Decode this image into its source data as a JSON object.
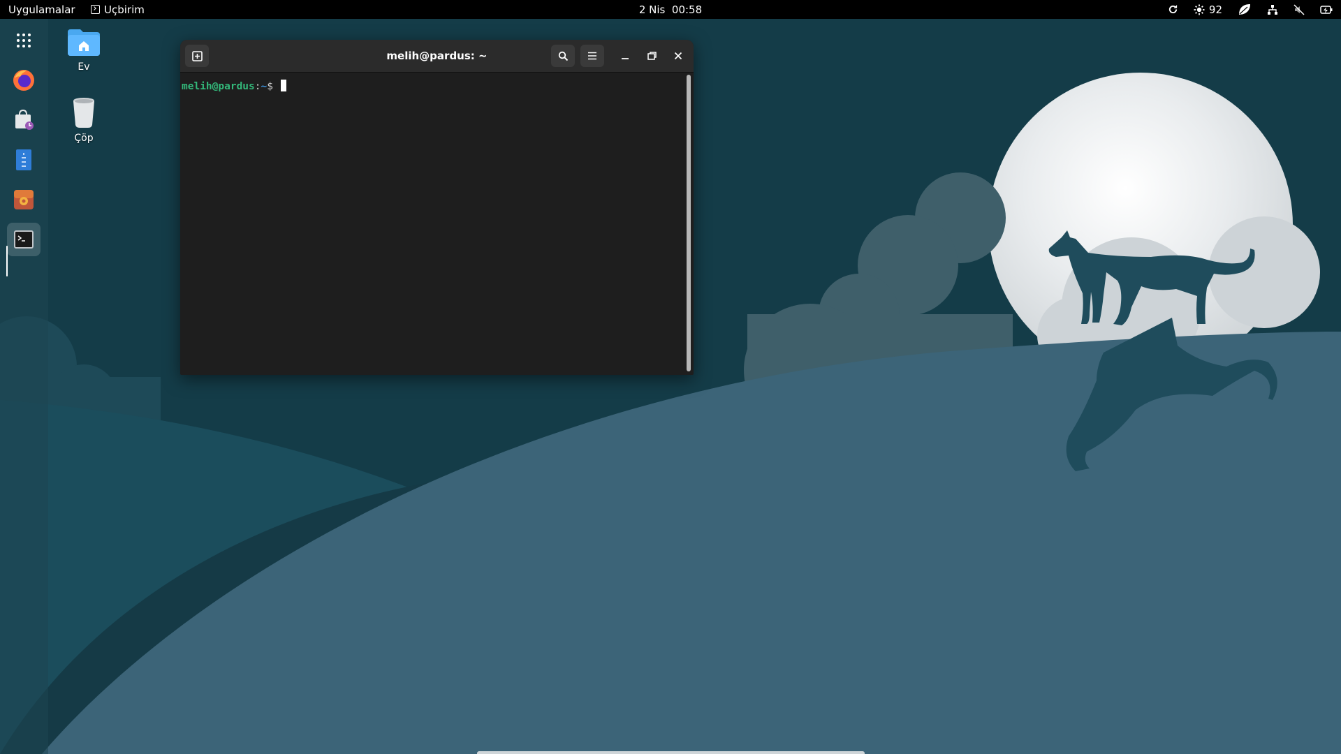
{
  "topbar": {
    "apps_label": "Uygulamalar",
    "active_app_label": "Uçbirim",
    "clock": "2 Nis  00:58",
    "brightness_value": "92"
  },
  "dock": {
    "items": [
      {
        "name": "app-grid",
        "icon": "app-grid-icon"
      },
      {
        "name": "firefox",
        "icon": "firefox-icon"
      },
      {
        "name": "software-store",
        "icon": "store-icon"
      },
      {
        "name": "text-editor",
        "icon": "text-editor-icon"
      },
      {
        "name": "package-installer",
        "icon": "package-icon"
      },
      {
        "name": "terminal",
        "icon": "terminal-icon",
        "active": true
      }
    ]
  },
  "desktop": {
    "icons": [
      {
        "label": "Ev",
        "icon": "home-folder-icon"
      },
      {
        "label": "Çöp",
        "icon": "trash-icon"
      }
    ]
  },
  "terminal": {
    "title": "melih@pardus: ~",
    "prompt_user": "melih@pardus",
    "prompt_sep": ":",
    "prompt_path": "~",
    "prompt_symbol": "$ "
  },
  "colors": {
    "topbar_bg": "#000000",
    "terminal_bg": "#1e1e1e",
    "prompt_user": "#33b87a",
    "prompt_path": "#3d8fd8",
    "wallpaper_sky": "#143c48",
    "wallpaper_hill": "#3c6478"
  }
}
